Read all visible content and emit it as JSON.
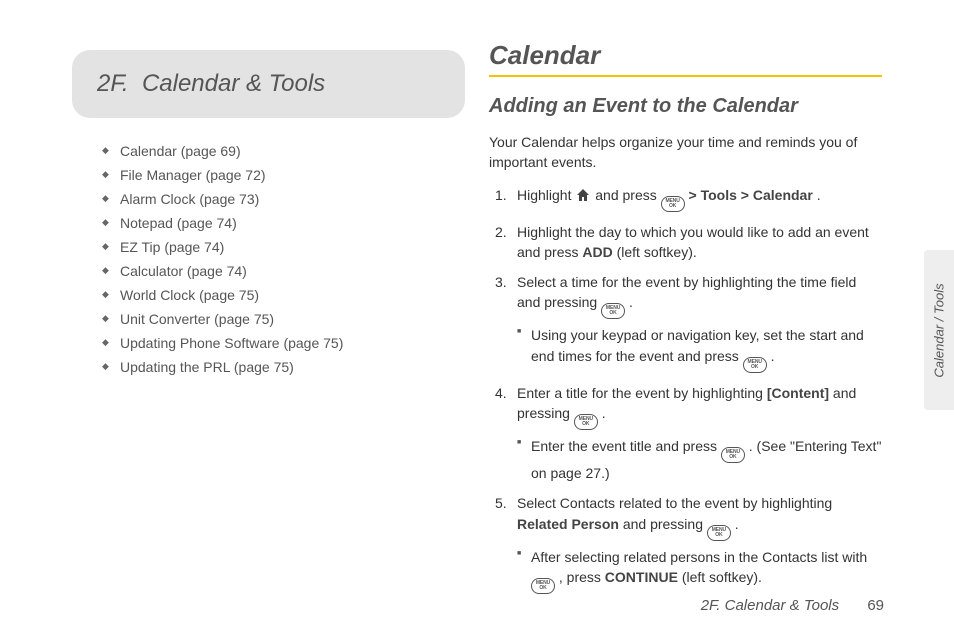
{
  "header": {
    "section_number": "2F.",
    "section_title": "Calendar & Tools"
  },
  "toc": [
    "Calendar (page 69)",
    "File Manager (page 72)",
    "Alarm Clock (page 73)",
    "Notepad (page 74)",
    "EZ Tip (page 74)",
    "Calculator (page 74)",
    "World Clock (page 75)",
    "Unit Converter (page 75)",
    "Updating Phone Software (page 75)",
    "Updating the PRL (page 75)"
  ],
  "main": {
    "title": "Calendar",
    "subtitle": "Adding an Event to the Calendar",
    "intro": "Your Calendar helps organize your time and reminds you of important events.",
    "steps": {
      "s1_a": "Highlight ",
      "s1_b": " and press ",
      "s1_c": " > ",
      "s1_tools": "Tools",
      "s1_d": " > ",
      "s1_cal": "Calendar",
      "s1_e": ".",
      "s2_a": "Highlight the day to which you would like to add an event and press ",
      "s2_add": "ADD",
      "s2_b": " (left softkey).",
      "s3_a": "Select a time for the event by highlighting the time field and pressing ",
      "s3_b": ".",
      "s3_sub_a": "Using your keypad or navigation key, set the start and end times for the event and press ",
      "s3_sub_b": ".",
      "s4_a": "Enter a title for the event by highlighting ",
      "s4_content": "[Content]",
      "s4_b": " and pressing ",
      "s4_c": ".",
      "s4_sub_a": "Enter the event title and press ",
      "s4_sub_b": ". (See \"Entering Text\" on page 27.)",
      "s5_a": "Select Contacts related to the event by highlighting ",
      "s5_related": "Related Person",
      "s5_b": " and pressing ",
      "s5_c": ".",
      "s5_sub_a": "After selecting related persons in the Contacts list with ",
      "s5_sub_b": ", press ",
      "s5_continue": "CONTINUE",
      "s5_sub_c": " (left softkey)."
    }
  },
  "icons": {
    "ok_label": "MENU OK"
  },
  "side_tab": "Calendar / Tools",
  "footer": {
    "label": "2F. Calendar & Tools",
    "page": "69"
  }
}
